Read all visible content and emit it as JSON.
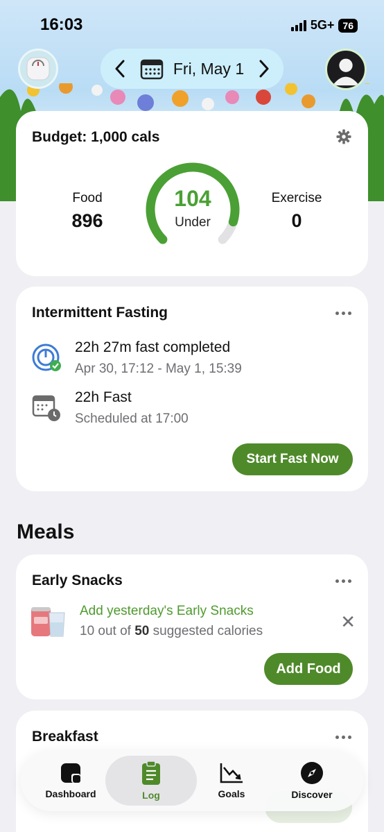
{
  "status_bar": {
    "time": "16:03",
    "network": "5G+",
    "battery": "76"
  },
  "header": {
    "date": "Fri, May 1",
    "prev_icon": "chevron-left-icon",
    "next_icon": "chevron-right-icon",
    "calendar_icon": "calendar-icon",
    "scale_icon": "scale-icon",
    "avatar_icon": "profile-avatar-icon"
  },
  "budget": {
    "title": "Budget: 1,000 cals",
    "food_label": "Food",
    "food_value": "896",
    "exercise_label": "Exercise",
    "exercise_value": "0",
    "remaining_value": "104",
    "remaining_label": "Under",
    "progress_fraction": 0.896,
    "accent": "#4aa034"
  },
  "fasting": {
    "title": "Intermittent Fasting",
    "completed_title": "22h 27m fast completed",
    "completed_range": "Apr 30, 17:12 - May 1, 15:39",
    "next_title": "22h Fast",
    "next_schedule": "Scheduled at 17:00",
    "start_button": "Start Fast Now"
  },
  "meals": {
    "section_title": "Meals",
    "early_snacks": {
      "title": "Early Snacks",
      "suggestion": "Add yesterday's Early Snacks",
      "sub_prefix": "10 out of ",
      "sub_bold": "50",
      "sub_suffix": " suggested calories",
      "add_button": "Add Food"
    },
    "breakfast": {
      "title": "Breakfast"
    }
  },
  "tabs": [
    {
      "label": "Dashboard",
      "icon": "dashboard-icon",
      "active": false
    },
    {
      "label": "Log",
      "icon": "log-clipboard-icon",
      "active": true
    },
    {
      "label": "Goals",
      "icon": "goals-chart-icon",
      "active": false
    },
    {
      "label": "Discover",
      "icon": "compass-icon",
      "active": false
    }
  ],
  "colors": {
    "brand_green": "#4f8a2a",
    "suggestion_green": "#4f9a2f",
    "background": "#efeff4"
  }
}
